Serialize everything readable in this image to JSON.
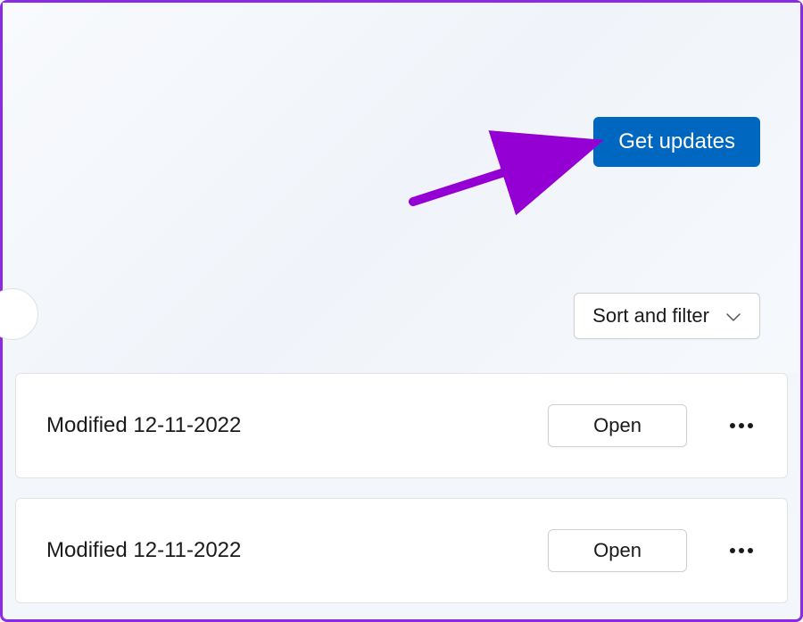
{
  "header": {
    "get_updates_label": "Get updates"
  },
  "toolbar": {
    "sort_filter_label": "Sort and filter"
  },
  "items": [
    {
      "modified_label": "Modified 12-11-2022",
      "open_label": "Open"
    },
    {
      "modified_label": "Modified 12-11-2022",
      "open_label": "Open"
    }
  ],
  "annotation": {
    "arrow_color": "#9400d3"
  }
}
